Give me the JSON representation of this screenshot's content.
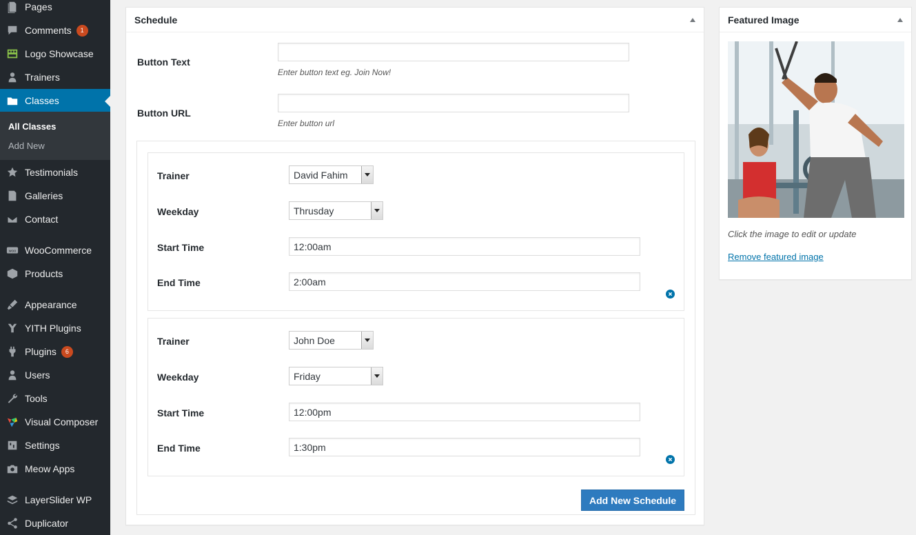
{
  "sidebar": {
    "items": [
      {
        "label": "Pages",
        "icon": "pages-icon"
      },
      {
        "label": "Comments",
        "icon": "comments-icon",
        "badge": "1"
      },
      {
        "label": "Logo Showcase",
        "icon": "logo-showcase-icon"
      },
      {
        "label": "Trainers",
        "icon": "trainers-icon"
      },
      {
        "label": "Classes",
        "icon": "folder-icon"
      },
      {
        "label": "Testimonials",
        "icon": "testimonials-icon"
      },
      {
        "label": "Galleries",
        "icon": "galleries-icon"
      },
      {
        "label": "Contact",
        "icon": "envelope-icon"
      },
      {
        "label": "WooCommerce",
        "icon": "woocommerce-icon"
      },
      {
        "label": "Products",
        "icon": "products-icon"
      },
      {
        "label": "Appearance",
        "icon": "appearance-icon"
      },
      {
        "label": "YITH Plugins",
        "icon": "yith-icon"
      },
      {
        "label": "Plugins",
        "icon": "plugins-icon",
        "badge": "6"
      },
      {
        "label": "Users",
        "icon": "users-icon"
      },
      {
        "label": "Tools",
        "icon": "tools-icon"
      },
      {
        "label": "Visual Composer",
        "icon": "visual-composer-icon"
      },
      {
        "label": "Settings",
        "icon": "settings-icon"
      },
      {
        "label": "Meow Apps",
        "icon": "camera-icon"
      },
      {
        "label": "LayerSlider WP",
        "icon": "layerslider-icon"
      },
      {
        "label": "Duplicator",
        "icon": "duplicator-icon"
      }
    ],
    "submenu": {
      "all_classes": "All Classes",
      "add_new": "Add New"
    }
  },
  "schedule": {
    "title": "Schedule",
    "button_text_label": "Button Text",
    "button_text_value": "",
    "button_text_hint": "Enter button text eg. Join Now!",
    "button_url_label": "Button URL",
    "button_url_value": "",
    "button_url_hint": "Enter button url",
    "entries": [
      {
        "trainer_label": "Trainer",
        "trainer": "David Fahim",
        "weekday_label": "Weekday",
        "weekday": "Thrusday",
        "start_label": "Start Time",
        "start": "12:00am",
        "end_label": "End Time",
        "end": "2:00am"
      },
      {
        "trainer_label": "Trainer",
        "trainer": "John Doe",
        "weekday_label": "Weekday",
        "weekday": "Friday",
        "start_label": "Start Time",
        "start": "12:00pm",
        "end_label": "End Time",
        "end": "1:30pm"
      }
    ],
    "add_button": "Add New Schedule"
  },
  "featured": {
    "title": "Featured Image",
    "caption": "Click the image to edit or update",
    "remove_link": "Remove featured image"
  },
  "colors": {
    "sidebar_bg": "#23282d",
    "active": "#0073aa",
    "badge": "#ca4a1f",
    "button": "#2e7bbf"
  }
}
